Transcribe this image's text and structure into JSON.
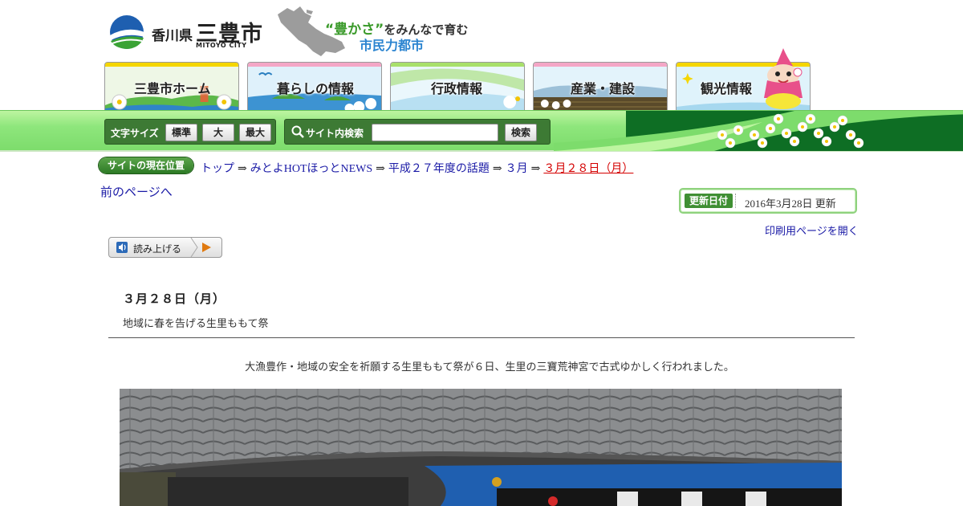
{
  "header": {
    "prefecture": "香川県",
    "city": "三豊市",
    "city_roman": "MITOYO CITY",
    "slogan_prefix": "“豊かさ”",
    "slogan_suffix": "をみんなで育む",
    "slogan_line2": "市民力都市"
  },
  "nav": {
    "tabs": [
      {
        "label": "三豊市ホーム"
      },
      {
        "label": "暮らしの情報"
      },
      {
        "label": "行政情報"
      },
      {
        "label": "産業・建設"
      },
      {
        "label": "観光情報"
      }
    ]
  },
  "toolbar": {
    "font_size_label": "文字サイズ",
    "font_sizes": [
      "標準",
      "大",
      "最大"
    ],
    "search_label": "サイト内検索",
    "search_button": "検索",
    "search_value": ""
  },
  "breadcrumb": {
    "badge": "サイトの現在位置",
    "separator": "⇒",
    "items": [
      "トップ",
      "みとよHOTほっとNEWS",
      "平成２７年度の話題",
      "３月",
      "３月２８日（月）"
    ]
  },
  "page": {
    "back_link": "前のページへ",
    "updated_label": "更新日付",
    "updated_text": "2016年3月28日 更新",
    "print_link": "印刷用ページを開く",
    "read_aloud": "読み上げる"
  },
  "article": {
    "title": "３月２８日（月）",
    "subtitle": "地域に春を告げる生里ももて祭",
    "body": "大漁豊作・地域の安全を祈願する生里ももて祭が６日、生里の三寶荒神宮で古式ゆかしく行われました。"
  },
  "colors": {
    "accent_green": "#3d7a34",
    "bar_green": "#8ee67c",
    "dark_green": "#0e6e24",
    "link_blue": "#1a1aa6",
    "current_red": "#d40000",
    "slogan_blue": "#2b84d0"
  }
}
